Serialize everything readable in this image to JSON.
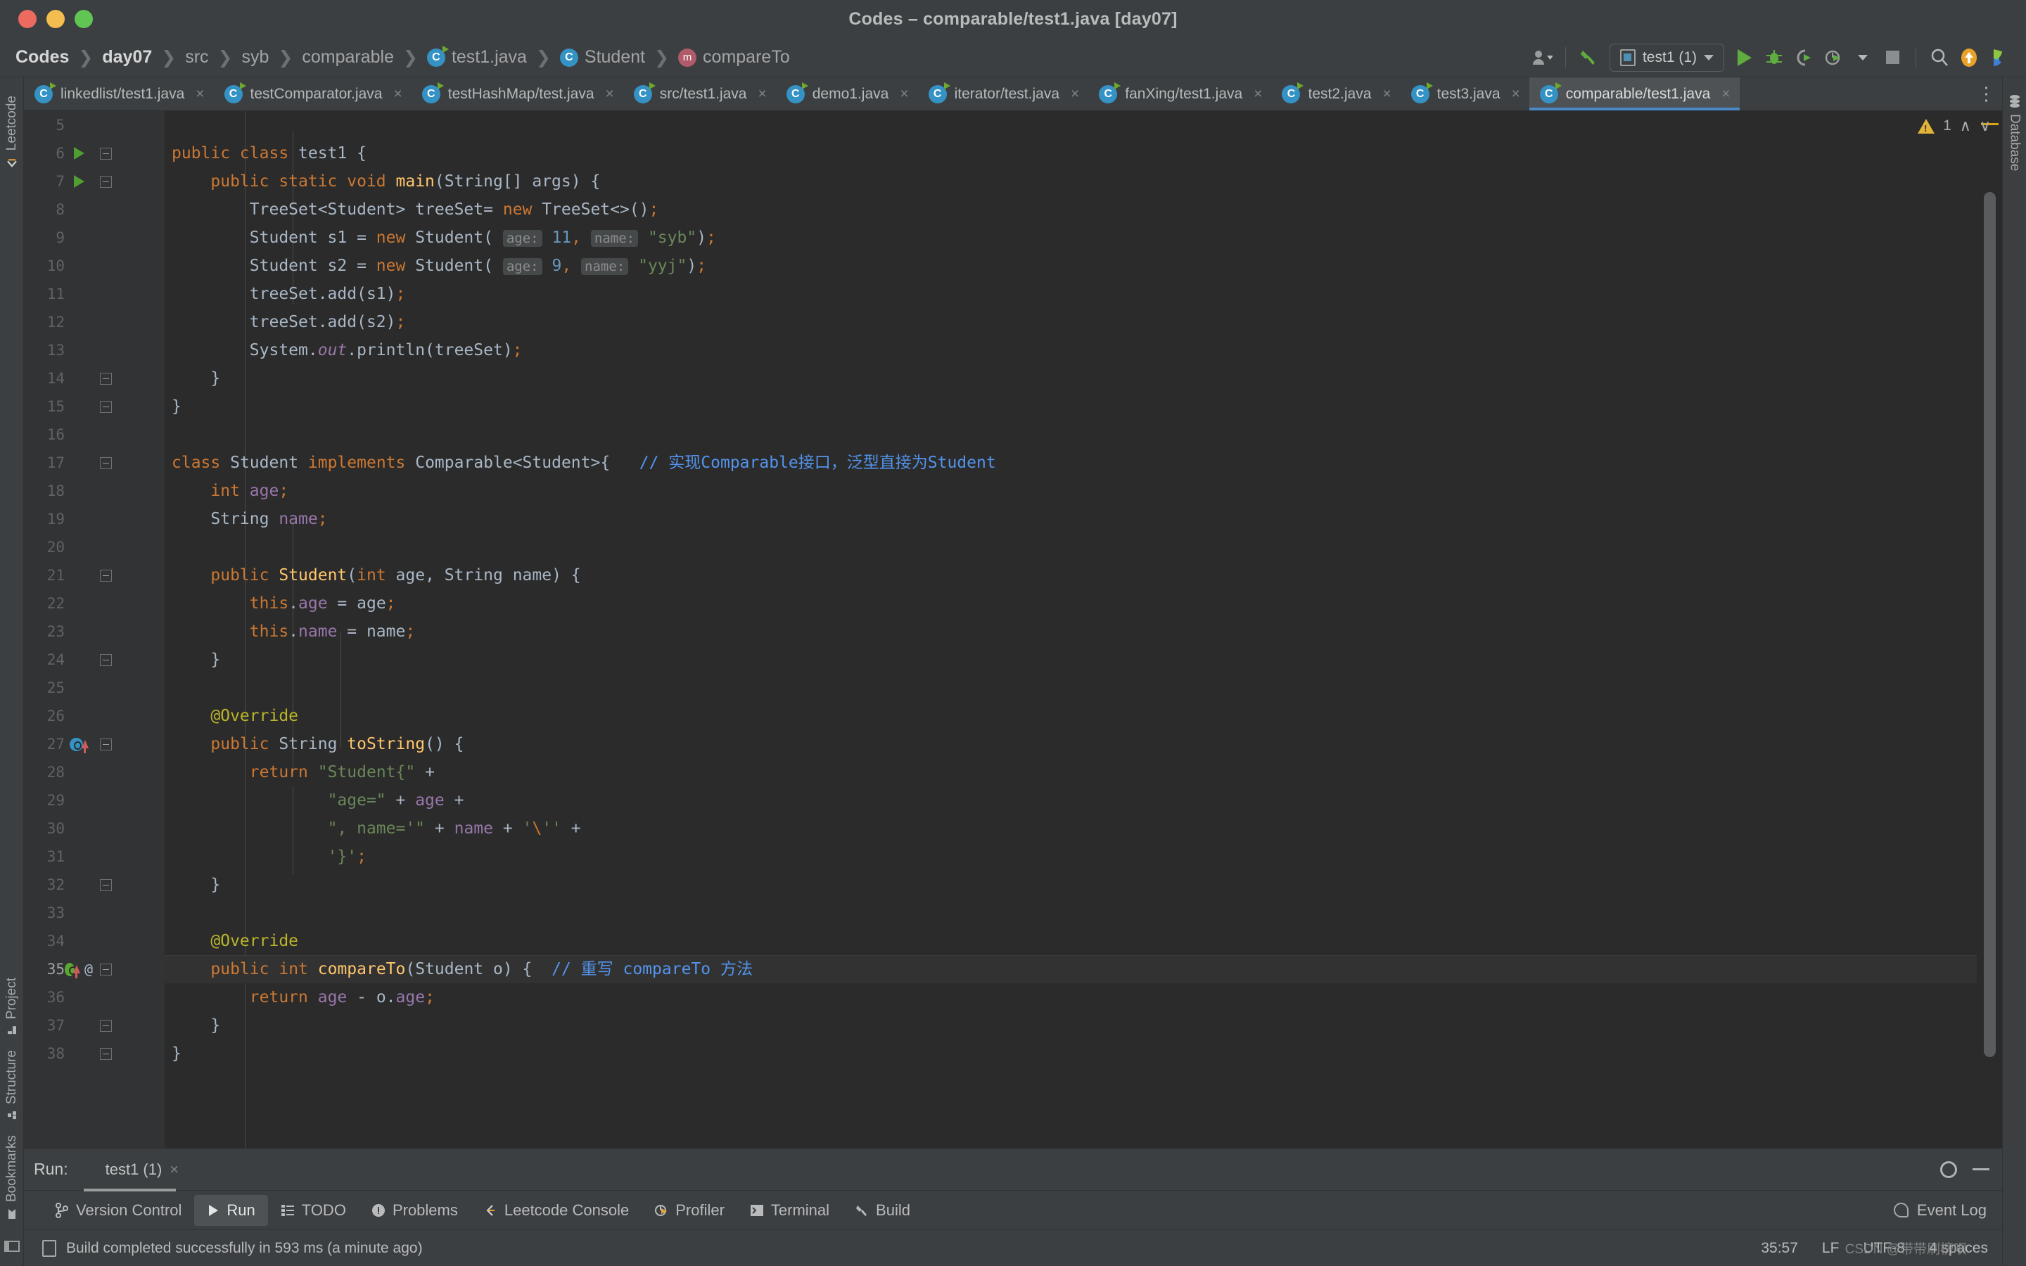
{
  "window": {
    "title": "Codes – comparable/test1.java [day07]",
    "traffic": [
      "close",
      "minimize",
      "zoom"
    ]
  },
  "breadcrumb": {
    "items": [
      {
        "label": "Codes",
        "bold": true,
        "icon": null
      },
      {
        "label": "day07",
        "bold": true,
        "icon": null
      },
      {
        "label": "src",
        "bold": false,
        "icon": null
      },
      {
        "label": "syb",
        "bold": false,
        "icon": null
      },
      {
        "label": "comparable",
        "bold": false,
        "icon": null
      },
      {
        "label": "test1.java",
        "bold": false,
        "icon": "java-class-runnable-icon"
      },
      {
        "label": "Student",
        "bold": false,
        "icon": "java-class-icon"
      },
      {
        "label": "compareTo",
        "bold": false,
        "icon": "method-icon"
      }
    ],
    "separator": "❯"
  },
  "toolbar": {
    "run_config": "test1 (1)",
    "buttons": [
      {
        "name": "user-account-button",
        "label": ""
      },
      {
        "name": "build-hammer-button",
        "label": ""
      },
      {
        "name": "run-button",
        "label": ""
      },
      {
        "name": "debug-button",
        "label": ""
      },
      {
        "name": "run-with-coverage-button",
        "label": ""
      },
      {
        "name": "profiler-button",
        "label": ""
      },
      {
        "name": "stop-button",
        "label": ""
      },
      {
        "name": "search-everywhere-button",
        "label": ""
      },
      {
        "name": "updates-button",
        "label": ""
      },
      {
        "name": "ide-assistant-button",
        "label": ""
      }
    ]
  },
  "tabs": {
    "items": [
      {
        "label": "linkedlist/test1.java",
        "active": false
      },
      {
        "label": "testComparator.java",
        "active": false
      },
      {
        "label": "testHashMap/test.java",
        "active": false
      },
      {
        "label": "src/test1.java",
        "active": false
      },
      {
        "label": "demo1.java",
        "active": false
      },
      {
        "label": "iterator/test.java",
        "active": false
      },
      {
        "label": "fanXing/test1.java",
        "active": false
      },
      {
        "label": "test2.java",
        "active": false
      },
      {
        "label": "test3.java",
        "active": false
      },
      {
        "label": "comparable/test1.java",
        "active": true
      }
    ],
    "close_glyph": "×",
    "more_glyph": "⋮"
  },
  "left_toolwindows": {
    "top": [
      {
        "label": "Leetcode",
        "icon": "leetcode-icon"
      }
    ],
    "bottom": [
      {
        "label": "Project",
        "icon": "project-icon"
      },
      {
        "label": "Structure",
        "icon": "structure-icon"
      },
      {
        "label": "Bookmarks",
        "icon": "bookmarks-icon"
      }
    ]
  },
  "right_toolwindows": {
    "items": [
      {
        "label": "Database",
        "icon": "database-icon"
      }
    ]
  },
  "inspection_widget": {
    "warning_count": "1",
    "up_glyph": "∧",
    "down_glyph": "∨"
  },
  "editor": {
    "first_visible_line": 5,
    "current_line": 35,
    "lines": [
      {
        "n": 5,
        "gutter": null,
        "fold": null,
        "current": false,
        "html": ""
      },
      {
        "n": 6,
        "gutter": "run",
        "fold": "start",
        "current": false,
        "html": "<span class=\"kw\">public class</span> <span class=\"punct\">test1</span> <span class=\"punct\">{</span>"
      },
      {
        "n": 7,
        "gutter": "run",
        "fold": "start",
        "current": false,
        "html": "    <span class=\"kw\">public static void</span> <span class=\"mth\">main</span><span class=\"punct\">(String[] args) {</span>"
      },
      {
        "n": 8,
        "gutter": null,
        "fold": null,
        "current": false,
        "html": "        <span class=\"punct\">TreeSet&lt;Student&gt; treeSet= </span><span class=\"kw\">new</span><span class=\"punct\"> TreeSet&lt;&gt;()</span><span class=\"semi\">;</span>"
      },
      {
        "n": 9,
        "gutter": null,
        "fold": null,
        "current": false,
        "html": "        <span class=\"punct\">Student s1 = </span><span class=\"kw\">new</span><span class=\"punct\"> Student( </span><span class=\"hint\">age:</span> <span class=\"num\">11</span><span class=\"semi\">,</span> <span class=\"hint\">name:</span> <span class=\"str\">\"syb\"</span><span class=\"punct\">)</span><span class=\"semi\">;</span>"
      },
      {
        "n": 10,
        "gutter": null,
        "fold": null,
        "current": false,
        "html": "        <span class=\"punct\">Student s2 = </span><span class=\"kw\">new</span><span class=\"punct\"> Student( </span><span class=\"hint\">age:</span> <span class=\"num\">9</span><span class=\"semi\">,</span> <span class=\"hint\">name:</span> <span class=\"str\">\"yyj\"</span><span class=\"punct\">)</span><span class=\"semi\">;</span>"
      },
      {
        "n": 11,
        "gutter": null,
        "fold": null,
        "current": false,
        "html": "        <span class=\"punct\">treeSet.add(s1)</span><span class=\"semi\">;</span>"
      },
      {
        "n": 12,
        "gutter": null,
        "fold": null,
        "current": false,
        "html": "        <span class=\"punct\">treeSet.add(s2)</span><span class=\"semi\">;</span>"
      },
      {
        "n": 13,
        "gutter": null,
        "fold": null,
        "current": false,
        "html": "        <span class=\"punct\">System.</span><span class=\"stat\">out</span><span class=\"punct\">.println(treeSet)</span><span class=\"semi\">;</span>"
      },
      {
        "n": 14,
        "gutter": null,
        "fold": "end",
        "current": false,
        "html": "    <span class=\"punct\">}</span>"
      },
      {
        "n": 15,
        "gutter": null,
        "fold": "end",
        "current": false,
        "html": "<span class=\"punct\">}</span>"
      },
      {
        "n": 16,
        "gutter": null,
        "fold": null,
        "current": false,
        "html": ""
      },
      {
        "n": 17,
        "gutter": null,
        "fold": "start",
        "current": false,
        "html": "<span class=\"kw\">class</span> <span class=\"punct\">Student </span><span class=\"kw\">implements</span> <span class=\"punct\">Comparable&lt;Student&gt;{</span>   <span class=\"cmt-b\">// 实现Comparable接口，泛型直接为Student</span>"
      },
      {
        "n": 18,
        "gutter": null,
        "fold": null,
        "current": false,
        "html": "    <span class=\"kw\">int</span> <span class=\"fld\">age</span><span class=\"semi\">;</span>"
      },
      {
        "n": 19,
        "gutter": null,
        "fold": null,
        "current": false,
        "html": "    <span class=\"punct\">String </span><span class=\"fld\">name</span><span class=\"semi\">;</span>"
      },
      {
        "n": 20,
        "gutter": null,
        "fold": null,
        "current": false,
        "html": ""
      },
      {
        "n": 21,
        "gutter": null,
        "fold": "start",
        "current": false,
        "html": "    <span class=\"kw\">public</span> <span class=\"mth\">Student</span><span class=\"punct\">(</span><span class=\"kw\">int</span><span class=\"punct\"> age, String name) {</span>"
      },
      {
        "n": 22,
        "gutter": null,
        "fold": null,
        "current": false,
        "html": "        <span class=\"kw\">this</span><span class=\"punct\">.</span><span class=\"fld\">age</span><span class=\"punct\"> = age</span><span class=\"semi\">;</span>"
      },
      {
        "n": 23,
        "gutter": null,
        "fold": null,
        "current": false,
        "html": "        <span class=\"kw\">this</span><span class=\"punct\">.</span><span class=\"fld\">name</span><span class=\"punct\"> = name</span><span class=\"semi\">;</span>"
      },
      {
        "n": 24,
        "gutter": null,
        "fold": "end",
        "current": false,
        "html": "    <span class=\"punct\">}</span>"
      },
      {
        "n": 25,
        "gutter": null,
        "fold": null,
        "current": false,
        "html": ""
      },
      {
        "n": 26,
        "gutter": null,
        "fold": null,
        "current": false,
        "html": "    <span class=\"ann\">@Override</span>"
      },
      {
        "n": 27,
        "gutter": "override",
        "fold": "start",
        "current": false,
        "html": "    <span class=\"kw\">public</span> <span class=\"punct\">String </span><span class=\"mth\">toString</span><span class=\"punct\">() {</span>"
      },
      {
        "n": 28,
        "gutter": null,
        "fold": null,
        "current": false,
        "html": "        <span class=\"kw\">return</span> <span class=\"str\">\"Student{\"</span><span class=\"punct\"> +</span>"
      },
      {
        "n": 29,
        "gutter": null,
        "fold": null,
        "current": false,
        "html": "                <span class=\"str\">\"age=\"</span><span class=\"punct\"> + </span><span class=\"fld\">age</span><span class=\"punct\"> +</span>"
      },
      {
        "n": 30,
        "gutter": null,
        "fold": null,
        "current": false,
        "html": "                <span class=\"str\">\", name='\"</span><span class=\"punct\"> + </span><span class=\"fld\">name</span><span class=\"punct\"> + </span><span class=\"str\">'</span><span class=\"esc\">\\</span><span class=\"str\">''</span><span class=\"punct\"> +</span>"
      },
      {
        "n": 31,
        "gutter": null,
        "fold": null,
        "current": false,
        "html": "                <span class=\"str\">'}'</span><span class=\"semi\">;</span>"
      },
      {
        "n": 32,
        "gutter": null,
        "fold": "end",
        "current": false,
        "html": "    <span class=\"punct\">}</span>"
      },
      {
        "n": 33,
        "gutter": null,
        "fold": null,
        "current": false,
        "html": ""
      },
      {
        "n": 34,
        "gutter": null,
        "fold": null,
        "current": false,
        "html": "    <span class=\"ann\">@Override</span>"
      },
      {
        "n": 35,
        "gutter": "override-green",
        "fold": "start",
        "current": true,
        "html": "    <span class=\"kw\">public</span> <span class=\"kw\">int</span> <span class=\"mth\">compareTo</span><span class=\"punct\">(Student o) {</span>  <span class=\"cmt-b\">// 重写 compareTo 方法</span>"
      },
      {
        "n": 36,
        "gutter": null,
        "fold": null,
        "current": false,
        "html": "        <span class=\"kw\">return</span> <span class=\"fld\">age</span><span class=\"punct\"> - o.</span><span class=\"fld\">age</span><span class=\"semi\">;</span>"
      },
      {
        "n": 37,
        "gutter": null,
        "fold": "end",
        "current": false,
        "html": "    <span class=\"punct\">}</span>"
      },
      {
        "n": 38,
        "gutter": null,
        "fold": "end",
        "current": false,
        "html": "<span class=\"punct\">}</span>"
      }
    ]
  },
  "run_panel": {
    "label": "Run:",
    "tab": "test1 (1)",
    "close_glyph": "×"
  },
  "tool_window_bar": {
    "items": [
      {
        "label": "Version Control",
        "icon": "branch-icon",
        "active": false
      },
      {
        "label": "Run",
        "icon": "run-icon",
        "active": true
      },
      {
        "label": "TODO",
        "icon": "todo-icon",
        "active": false
      },
      {
        "label": "Problems",
        "icon": "problems-icon",
        "active": false
      },
      {
        "label": "Leetcode Console",
        "icon": "leetcode-icon",
        "active": false
      },
      {
        "label": "Profiler",
        "icon": "profiler-icon",
        "active": false
      },
      {
        "label": "Terminal",
        "icon": "terminal-icon",
        "active": false
      },
      {
        "label": "Build",
        "icon": "build-icon",
        "active": false
      }
    ],
    "event_log": "Event Log"
  },
  "status_bar": {
    "message": "Build completed successfully in 593 ms (a minute ago)",
    "caret_position": "35:57",
    "line_separator": "LF",
    "encoding": "UTF-8",
    "indent": "4 spaces",
    "watermark": "CSDN @带带刷榜呗"
  },
  "colors": {
    "accent_blue": "#4a88c7",
    "run_green": "#5fad3f",
    "warning_yellow": "#e2b339",
    "editor_bg": "#2b2b2b",
    "chrome_bg": "#3c3f41",
    "gutter_bg": "#313335",
    "comment_blue": "#5394ec",
    "string_green": "#6a8759",
    "keyword_orange": "#cc7832"
  }
}
